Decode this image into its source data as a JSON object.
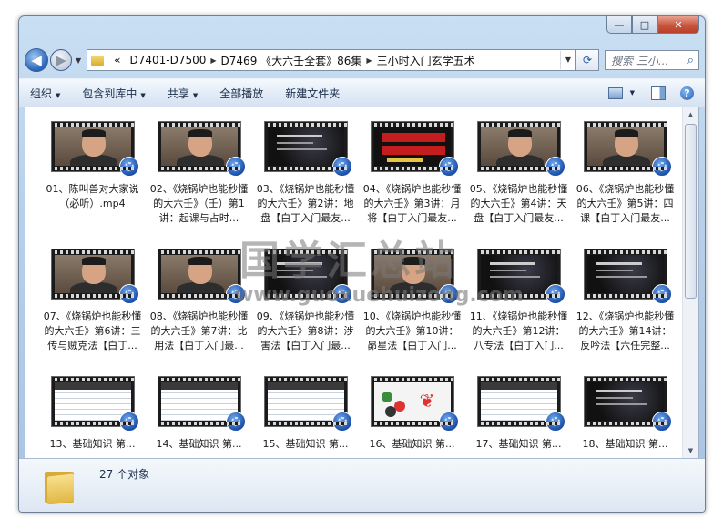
{
  "window": {
    "caption": {
      "minimize": "—",
      "maximize": "□",
      "close": "✕"
    }
  },
  "nav": {
    "back_glyph": "◀",
    "forward_glyph": "▶",
    "breadcrumbs": [
      "D7401-D7500",
      "D7469 《大六壬全套》86集",
      "三小时入门玄学五术"
    ],
    "crumb_prefix": "«",
    "refresh_glyph": "⟳",
    "search_placeholder": "搜索 三小...",
    "search_icon": "⌕"
  },
  "toolbar": {
    "organize": "组织",
    "include_in_library": "包含到库中",
    "share": "共享",
    "play_all": "全部播放",
    "new_folder": "新建文件夹",
    "help": "?"
  },
  "files": [
    {
      "name": "01、陈叫兽对大家说（必听）.mp4",
      "thumb": "person"
    },
    {
      "name": "02、《烧锅炉也能秒懂的大六壬》（壬）第1讲：起课与占时...",
      "thumb": "person"
    },
    {
      "name": "03、《烧锅炉也能秒懂的大六壬》第2讲：地盘【白丁入门最友...",
      "thumb": "dark"
    },
    {
      "name": "04、《烧锅炉也能秒懂的大六壬》第3讲：月将【白丁入门最友...",
      "thumb": "red"
    },
    {
      "name": "05、《烧锅炉也能秒懂的大六壬》第4讲：天盘【白丁入门最友...",
      "thumb": "person"
    },
    {
      "name": "06、《烧锅炉也能秒懂的大六壬》第5讲：四课【白丁入门最友...",
      "thumb": "person"
    },
    {
      "name": "07、《烧锅炉也能秒懂的大六壬》第6讲：三传与贼克法【白丁...",
      "thumb": "person"
    },
    {
      "name": "08、《烧锅炉也能秒懂的大六壬》第7讲：比用法【白丁入门最...",
      "thumb": "person"
    },
    {
      "name": "09、《烧锅炉也能秒懂的大六壬》第8讲：涉害法【白丁入门最...",
      "thumb": "dark"
    },
    {
      "name": "10、《烧锅炉也能秒懂的大六壬》第10讲：昴星法【白丁入门...",
      "thumb": "person"
    },
    {
      "name": "11、《烧锅炉也能秒懂的大六壬》第12讲：八专法【白丁入门...",
      "thumb": "dark"
    },
    {
      "name": "12、《烧锅炉也能秒懂的大六壬》第14讲：反吟法【六任完整...",
      "thumb": "dark"
    },
    {
      "name": "13、基础知识 第...",
      "thumb": "table"
    },
    {
      "name": "14、基础知识 第...",
      "thumb": "table"
    },
    {
      "name": "15、基础知识 第...",
      "thumb": "table"
    },
    {
      "name": "16、基础知识 第...",
      "thumb": "colors"
    },
    {
      "name": "17、基础知识 第...",
      "thumb": "table"
    },
    {
      "name": "18、基础知识 第...",
      "thumb": "dark"
    }
  ],
  "status": {
    "count": "27 个对象"
  },
  "watermark": {
    "title": "国学汇总站",
    "url": "www.guoxuehuizong.com"
  }
}
